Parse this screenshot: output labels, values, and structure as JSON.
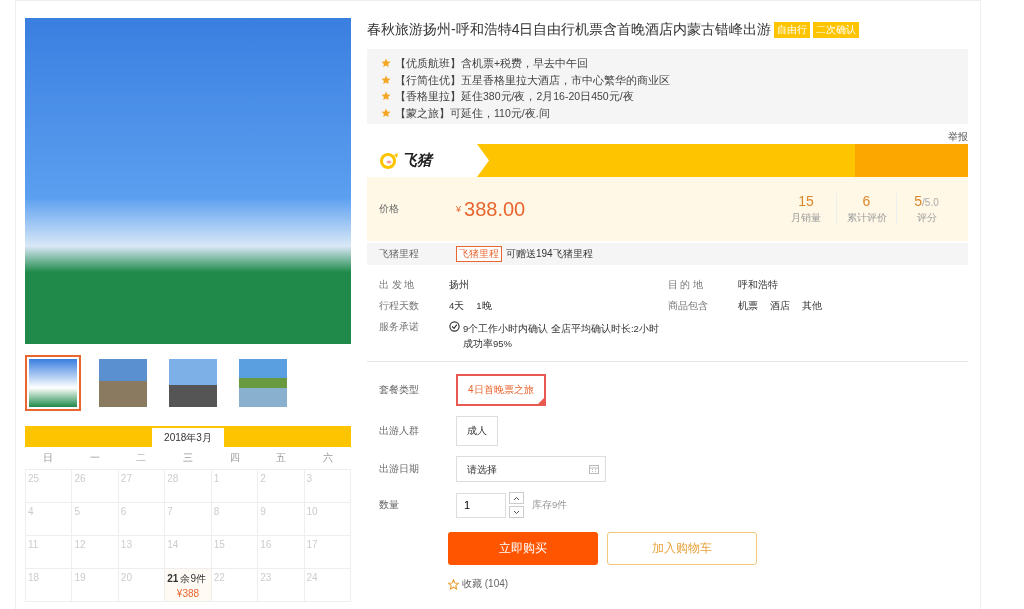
{
  "gallery": {
    "thumbnails": [
      {
        "selected": true
      },
      {
        "selected": false
      },
      {
        "selected": false
      },
      {
        "selected": false
      }
    ]
  },
  "calendar": {
    "month": "2018年3月",
    "weekdays": [
      "日",
      "一",
      "二",
      "三",
      "四",
      "五",
      "六"
    ],
    "weeks": [
      [
        {
          "day": "25",
          "available": false
        },
        {
          "day": "26",
          "available": false
        },
        {
          "day": "27",
          "available": false
        },
        {
          "day": "28",
          "available": false
        },
        {
          "day": "1",
          "available": false
        },
        {
          "day": "2",
          "available": false
        },
        {
          "day": "3",
          "available": false
        }
      ],
      [
        {
          "day": "4",
          "available": false
        },
        {
          "day": "5",
          "available": false
        },
        {
          "day": "6",
          "available": false
        },
        {
          "day": "7",
          "available": false
        },
        {
          "day": "8",
          "available": false
        },
        {
          "day": "9",
          "available": false
        },
        {
          "day": "10",
          "available": false
        }
      ],
      [
        {
          "day": "11",
          "available": false
        },
        {
          "day": "12",
          "available": false
        },
        {
          "day": "13",
          "available": false
        },
        {
          "day": "14",
          "available": false
        },
        {
          "day": "15",
          "available": false
        },
        {
          "day": "16",
          "available": false
        },
        {
          "day": "17",
          "available": false
        }
      ],
      [
        {
          "day": "18",
          "available": false
        },
        {
          "day": "19",
          "available": false
        },
        {
          "day": "20",
          "available": false
        },
        {
          "day": "21",
          "available": true,
          "stock": "余9件",
          "price": "¥388"
        },
        {
          "day": "22",
          "available": false
        },
        {
          "day": "23",
          "available": false
        },
        {
          "day": "24",
          "available": false
        }
      ]
    ]
  },
  "product": {
    "title": "春秋旅游扬州-呼和浩特4日自由行机票含首晚酒店内蒙古错峰出游",
    "tags": [
      "自由行",
      "二次确认"
    ],
    "highlights": [
      {
        "label": "【优质航班】",
        "text": "含机票+税费，早去中午回"
      },
      {
        "label": "【行简住优】",
        "text": "五星香格里拉大酒店，市中心繁华的商业区"
      },
      {
        "label": "【香格里拉】",
        "text": "延住380元/夜，2月16-20日450元/夜"
      },
      {
        "label": "【蒙之旅】",
        "text": "可延住，110元/夜.间"
      }
    ],
    "report_link": "举报",
    "brand": "飞猪",
    "price_label": "价格",
    "currency": "¥",
    "price": "388.00",
    "stats": [
      {
        "value": "15",
        "label": "月销量"
      },
      {
        "value": "6",
        "label": "累计评价"
      },
      {
        "value": "5",
        "suffix": "/5.0",
        "label": "评分"
      }
    ],
    "mileage": {
      "label": "飞猪里程",
      "badge": "飞猪里程",
      "text": "可赠送194飞猪里程"
    },
    "details": [
      {
        "kind": "text",
        "label": "出 发 地",
        "values": [
          "扬州"
        ]
      },
      {
        "kind": "text",
        "label": "目 的 地",
        "values": [
          "呼和浩特"
        ]
      },
      {
        "kind": "text",
        "label": "行程天数",
        "values": [
          "4天",
          "1晚"
        ]
      },
      {
        "kind": "text",
        "label": "商品包含",
        "values": [
          "机票",
          "酒店",
          "其他"
        ]
      },
      {
        "kind": "promise",
        "label": "服务承诺",
        "values": [
          "9个工作小时内确认 全店平均确认时长:2小时",
          "成功率95%"
        ]
      }
    ],
    "package": {
      "label": "套餐类型",
      "options": [
        {
          "label": "4日首晚票之旅",
          "selected": true
        }
      ]
    },
    "crowd": {
      "label": "出游人群",
      "options": [
        {
          "label": "成人",
          "selected": false
        }
      ]
    },
    "date": {
      "label": "出游日期",
      "placeholder": "请选择"
    },
    "quantity": {
      "label": "数量",
      "value": "1",
      "stock": "库存9件"
    },
    "buy_button": "立即购买",
    "cart_button": "加入购物车",
    "favorite": {
      "label": "收藏",
      "count": "(104)"
    }
  }
}
